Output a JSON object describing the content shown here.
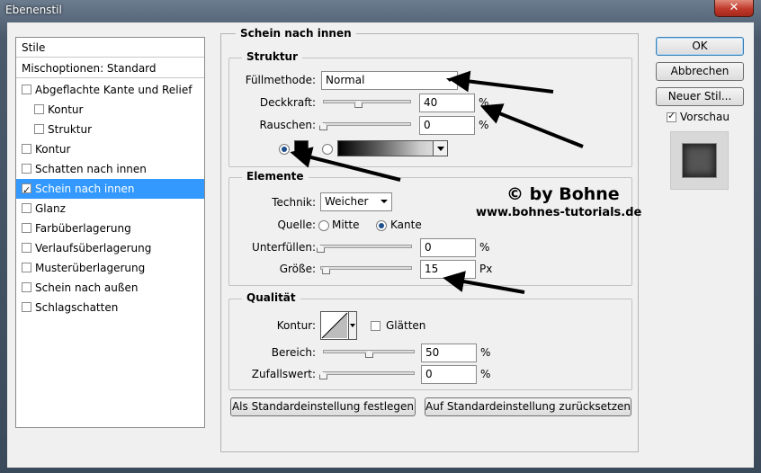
{
  "window": {
    "title": "Ebenenstil",
    "close_glyph": "✕"
  },
  "stylelist": {
    "header": "Stile",
    "blend_options": "Mischoptionen: Standard",
    "items": [
      {
        "label": "Abgeflachte Kante und Relief",
        "checked": false
      },
      {
        "label": "Kontur",
        "checked": false
      },
      {
        "label": "Struktur",
        "checked": false
      },
      {
        "label": "Kontur",
        "checked": false
      },
      {
        "label": "Schatten nach innen",
        "checked": false
      },
      {
        "label": "Schein nach innen",
        "checked": true,
        "selected": true
      },
      {
        "label": "Glanz",
        "checked": false
      },
      {
        "label": "Farbüberlagerung",
        "checked": false
      },
      {
        "label": "Verlaufsüberlagerung",
        "checked": false
      },
      {
        "label": "Musterüberlagerung",
        "checked": false
      },
      {
        "label": "Schein nach außen",
        "checked": false
      },
      {
        "label": "Schlagschatten",
        "checked": false
      }
    ]
  },
  "panel": {
    "title": "Schein nach innen",
    "struktur": {
      "title": "Struktur",
      "blend_label": "Füllmethode:",
      "blend_value": "Normal",
      "opacity_label": "Deckkraft:",
      "opacity_value": "40",
      "opacity_unit": "%",
      "opacity_level": 0.4,
      "noise_label": "Rauschen:",
      "noise_value": "0",
      "noise_unit": "%",
      "noise_level": 0.0,
      "color_swatch": "#000000"
    },
    "elemente": {
      "title": "Elemente",
      "technique_label": "Technik:",
      "technique_value": "Weicher",
      "source_label": "Quelle:",
      "source_center": "Mitte",
      "source_edge": "Kante",
      "choke_label": "Unterfüllen:",
      "choke_value": "0",
      "choke_unit": "%",
      "choke_level": 0.0,
      "size_label": "Größe:",
      "size_value": "15",
      "size_unit": "Px",
      "size_level": 0.06
    },
    "qualitaet": {
      "title": "Qualität",
      "contour_label": "Kontur:",
      "antialias_label": "Glätten",
      "range_label": "Bereich:",
      "range_value": "50",
      "range_unit": "%",
      "range_level": 0.5,
      "jitter_label": "Zufallswert:",
      "jitter_value": "0",
      "jitter_unit": "%",
      "jitter_level": 0.0
    },
    "make_default": "Als Standardeinstellung festlegen",
    "reset_default": "Auf Standardeinstellung zurücksetzen"
  },
  "watermark": {
    "line1": "© by Bohne",
    "line2": "www.bohnes-tutorials.de"
  },
  "buttons": {
    "ok": "OK",
    "cancel": "Abbrechen",
    "new_style": "Neuer Stil...",
    "preview": "Vorschau"
  }
}
